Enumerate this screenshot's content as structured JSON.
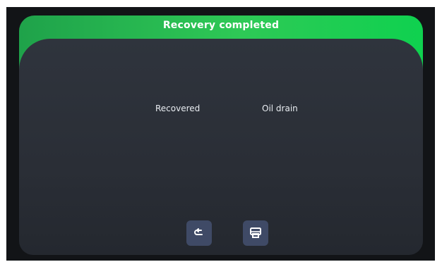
{
  "header": {
    "title": "Recovery completed"
  },
  "content": {
    "recovered_label": "Recovered",
    "oil_drain_label": "Oil drain"
  },
  "buttons": {
    "back_icon": "return-icon",
    "print_icon": "printer-icon"
  },
  "colors": {
    "header_green": "#2ec956",
    "panel_bg": "#2a2e36",
    "button_bg": "#3f4a66"
  }
}
